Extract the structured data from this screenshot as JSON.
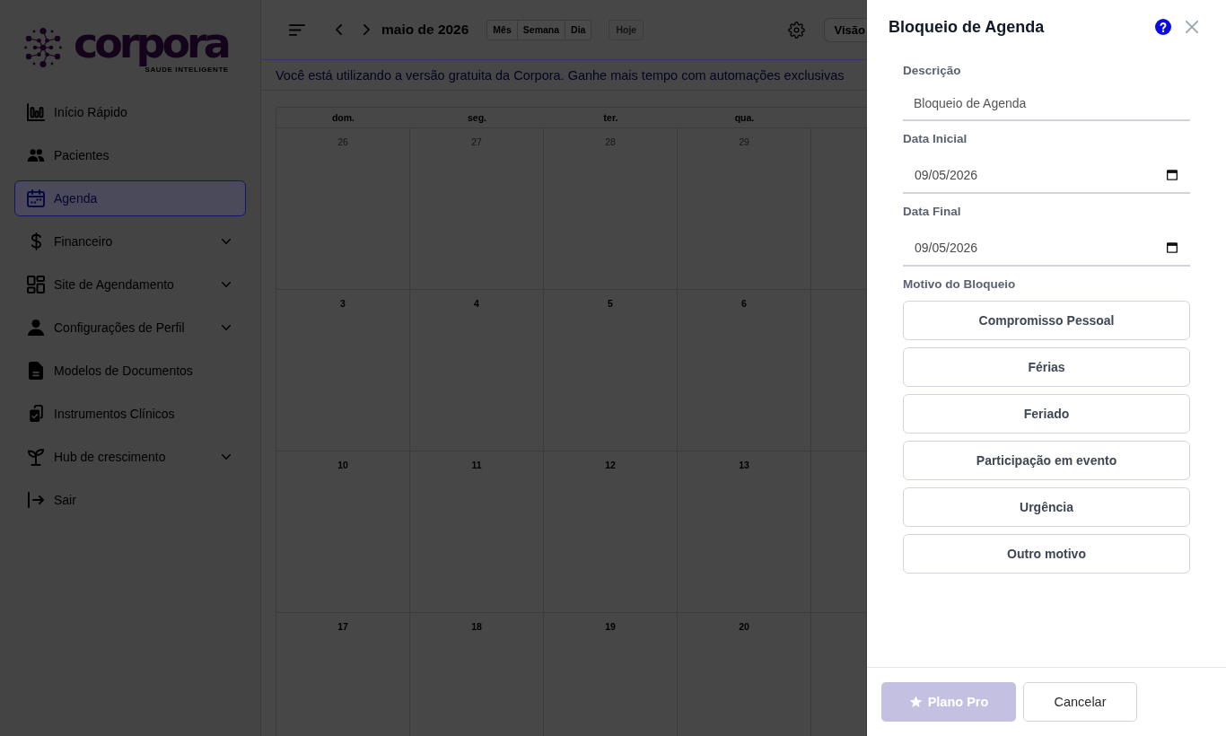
{
  "sidebar": {
    "logo": {
      "wordmark": "corpora",
      "tagline": "SAUDE INTELIGENTE"
    },
    "items": [
      {
        "label": "Início Rápido",
        "selected": false,
        "expandable": false
      },
      {
        "label": "Pacientes",
        "selected": false,
        "expandable": false
      },
      {
        "label": "Agenda",
        "selected": true,
        "expandable": false
      },
      {
        "label": "Financeiro",
        "selected": false,
        "expandable": true
      },
      {
        "label": "Site de Agendamento",
        "selected": false,
        "expandable": true
      },
      {
        "label": "Configurações de Perfil",
        "selected": false,
        "expandable": true
      },
      {
        "label": "Modelos de Documentos",
        "selected": false,
        "expandable": false
      },
      {
        "label": "Instrumentos Clínicos",
        "selected": false,
        "expandable": false
      },
      {
        "label": "Hub de crescimento",
        "selected": false,
        "expandable": true
      },
      {
        "label": "Sair",
        "selected": false,
        "expandable": false
      }
    ]
  },
  "toolbar": {
    "title": "maio de 2026",
    "views": [
      "Mês",
      "Semana",
      "Dia"
    ],
    "today": {
      "label": "Hoje",
      "disabled": true
    },
    "view_menu": {
      "label": "Visão"
    }
  },
  "banner": {
    "text": "Você está utilizando a versão gratuita da Corpora. Ganhe mais tempo com automações exclusivas"
  },
  "calendar": {
    "weekdays": [
      "dom.",
      "seg.",
      "ter.",
      "qua."
    ],
    "weeks": [
      {
        "days": [
          {
            "label": "26",
            "other_month": true
          },
          {
            "label": "27",
            "other_month": true
          },
          {
            "label": "28",
            "other_month": true
          },
          {
            "label": "29",
            "other_month": true
          }
        ]
      },
      {
        "days": [
          {
            "label": "3",
            "other_month": false
          },
          {
            "label": "4",
            "other_month": false
          },
          {
            "label": "5",
            "other_month": false
          },
          {
            "label": "6",
            "other_month": false
          }
        ]
      },
      {
        "days": [
          {
            "label": "10",
            "other_month": false
          },
          {
            "label": "11",
            "other_month": false
          },
          {
            "label": "12",
            "other_month": false
          },
          {
            "label": "13",
            "other_month": false
          }
        ]
      },
      {
        "days": [
          {
            "label": "17",
            "other_month": false
          },
          {
            "label": "18",
            "other_month": false
          },
          {
            "label": "19",
            "other_month": false
          },
          {
            "label": "20",
            "other_month": false
          }
        ]
      }
    ]
  },
  "drawer": {
    "title": "Bloqueio de Agenda",
    "fields": [
      {
        "kind": "text",
        "label": "Descrição",
        "value": "Bloqueio de Agenda"
      },
      {
        "kind": "date",
        "label": "Data Inicial",
        "value": "09/05/2026"
      },
      {
        "kind": "date",
        "label": "Data Final",
        "value": "09/05/2026"
      }
    ],
    "reason": {
      "label": "Motivo do Bloqueio",
      "options": [
        {
          "label": "Compromisso Pessoal",
          "selected": false
        },
        {
          "label": "Férias",
          "selected": false
        },
        {
          "label": "Feriado",
          "selected": false
        },
        {
          "label": "Participação em evento",
          "selected": false
        },
        {
          "label": "Urgência",
          "selected": false
        },
        {
          "label": "Outro motivo",
          "selected": false
        }
      ]
    },
    "actions": [
      {
        "kind": "primary",
        "label": "Plano Pro",
        "disabled": true
      },
      {
        "kind": "secondary",
        "label": "Cancelar",
        "disabled": false
      }
    ]
  }
}
